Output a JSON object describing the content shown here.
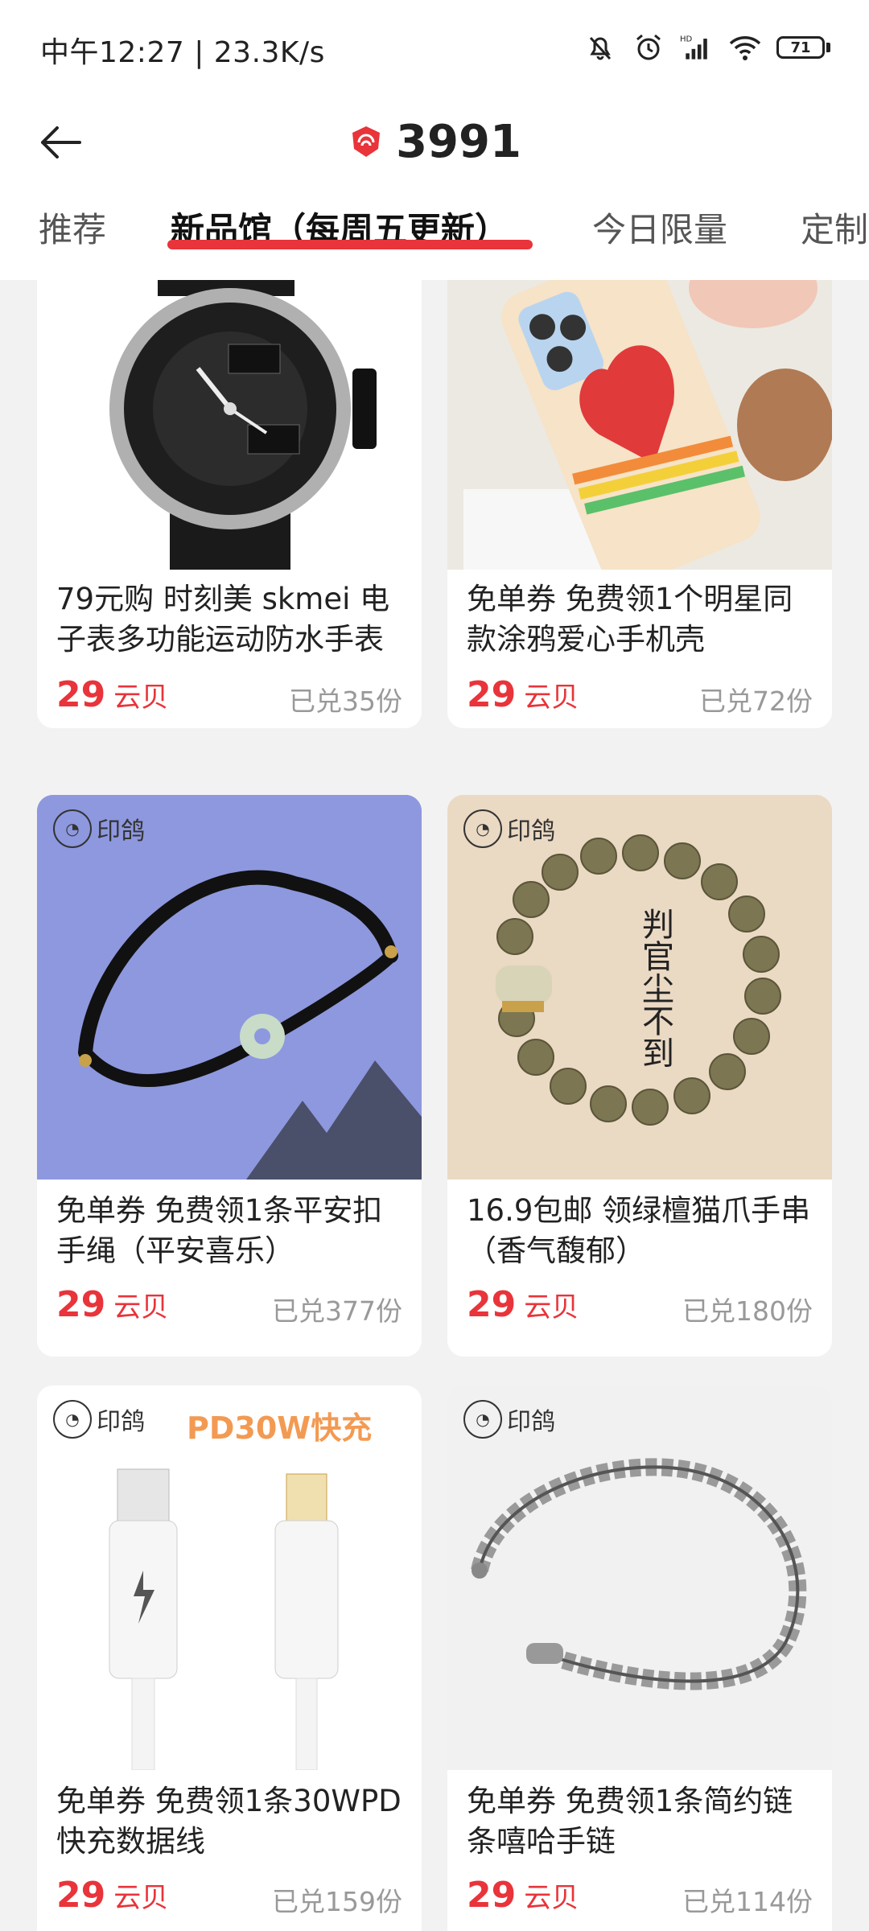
{
  "status_bar": {
    "time_speed": "中午12:27 | 23.3K/s",
    "battery": "71",
    "icons": [
      "mute-bell-icon",
      "alarm-icon",
      "hd-signal-icon",
      "wifi-icon",
      "battery-icon"
    ]
  },
  "header": {
    "title": "3991",
    "coin_icon": "cloud-coin-icon",
    "back_icon": "back-arrow-icon"
  },
  "tabs": [
    {
      "label": "推荐"
    },
    {
      "label": "新品馆（每周五更新）"
    },
    {
      "label": "今日限量"
    },
    {
      "label": "定制"
    }
  ],
  "colors": {
    "accent": "#e8343a",
    "card_bg": "#ffffff",
    "page_bg": "#f2f2f2"
  },
  "products": [
    {
      "title": "79元购 时刻美 skmei 电子表多功能运动防水手表",
      "price": "29",
      "unit": "云贝",
      "sold": "已兑35份"
    },
    {
      "title": "免单券 免费领1个明星同款涂鸦爱心手机壳",
      "price": "29",
      "unit": "云贝",
      "sold": "已兑72份"
    },
    {
      "title": "免单券 免费领1条平安扣手绳（平安喜乐）",
      "price": "29",
      "unit": "云贝",
      "sold": "已兑377份",
      "brand": "印鸽"
    },
    {
      "title": "16.9包邮 领绿檀猫爪手串（香气馥郁）",
      "price": "29",
      "unit": "云贝",
      "sold": "已兑180份",
      "brand": "印鸽",
      "image_text": "判官尘不到"
    },
    {
      "title": "免单券 免费领1条30WPD快充数据线",
      "price": "29",
      "unit": "云贝",
      "sold": "已兑159份",
      "brand": "印鸽",
      "image_text": "PD30W快充"
    },
    {
      "title": "免单券 免费领1条简约链条嘻哈手链",
      "price": "29",
      "unit": "云贝",
      "sold": "已兑114份",
      "brand": "印鸽"
    }
  ]
}
